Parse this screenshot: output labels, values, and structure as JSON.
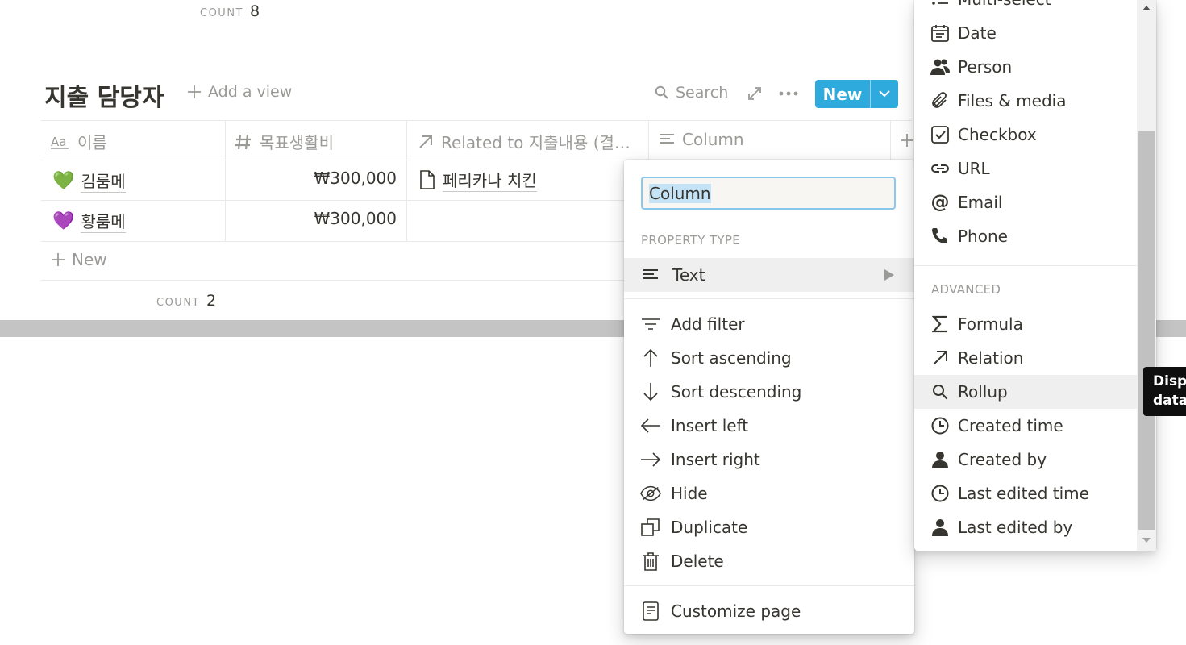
{
  "top_count": {
    "label": "COUNT",
    "value": "8"
  },
  "header": {
    "title": "지출 담당자",
    "add_view": "Add a view",
    "search": "Search",
    "new_button": "New"
  },
  "table": {
    "columns": [
      {
        "label": "이름",
        "icon": "text-aa-icon"
      },
      {
        "label": "목표생활비",
        "icon": "hash-icon"
      },
      {
        "label": "Related to 지출내용 (결…",
        "icon": "arrow-up-right-icon"
      },
      {
        "label": "Column",
        "icon": "lines-icon"
      }
    ],
    "rows": [
      {
        "emoji": "💚",
        "name": "김룸메",
        "budget": "₩300,000",
        "related": "페리카나 치킨"
      },
      {
        "emoji": "💜",
        "name": "황룸메",
        "budget": "₩300,000",
        "related": ""
      }
    ],
    "new_row": "New",
    "count_label": "COUNT",
    "count_value": "2"
  },
  "menu": {
    "input_value": "Column",
    "section_label": "PROPERTY TYPE",
    "type_selected": "Text",
    "actions": [
      {
        "label": "Add filter",
        "icon": "filter-icon"
      },
      {
        "label": "Sort ascending",
        "icon": "arrow-up-icon"
      },
      {
        "label": "Sort descending",
        "icon": "arrow-down-icon"
      },
      {
        "label": "Insert left",
        "icon": "arrow-left-icon"
      },
      {
        "label": "Insert right",
        "icon": "arrow-right-icon"
      },
      {
        "label": "Hide",
        "icon": "eye-off-icon"
      },
      {
        "label": "Duplicate",
        "icon": "duplicate-icon"
      },
      {
        "label": "Delete",
        "icon": "trash-icon"
      }
    ],
    "customize": "Customize page"
  },
  "types": {
    "partial_top": "Multi-select",
    "basic": [
      {
        "label": "Date",
        "icon": "calendar-icon"
      },
      {
        "label": "Person",
        "icon": "people-icon"
      },
      {
        "label": "Files & media",
        "icon": "paperclip-icon"
      },
      {
        "label": "Checkbox",
        "icon": "checkbox-icon"
      },
      {
        "label": "URL",
        "icon": "link-icon"
      },
      {
        "label": "Email",
        "icon": "at-icon"
      },
      {
        "label": "Phone",
        "icon": "phone-icon"
      }
    ],
    "advanced_label": "ADVANCED",
    "advanced": [
      {
        "label": "Formula",
        "icon": "sigma-icon"
      },
      {
        "label": "Relation",
        "icon": "arrow-up-right-icon"
      },
      {
        "label": "Rollup",
        "icon": "search-icon"
      },
      {
        "label": "Created time",
        "icon": "clock-icon"
      },
      {
        "label": "Created by",
        "icon": "user-icon"
      },
      {
        "label": "Last edited time",
        "icon": "clock-icon"
      },
      {
        "label": "Last edited by",
        "icon": "user-icon"
      }
    ],
    "hovered": "Rollup"
  },
  "tooltip": {
    "line1": "Displ",
    "line2": "data"
  },
  "colors": {
    "accent": "#2eaadc",
    "text": "#37352f",
    "muted": "#9b9a97"
  }
}
